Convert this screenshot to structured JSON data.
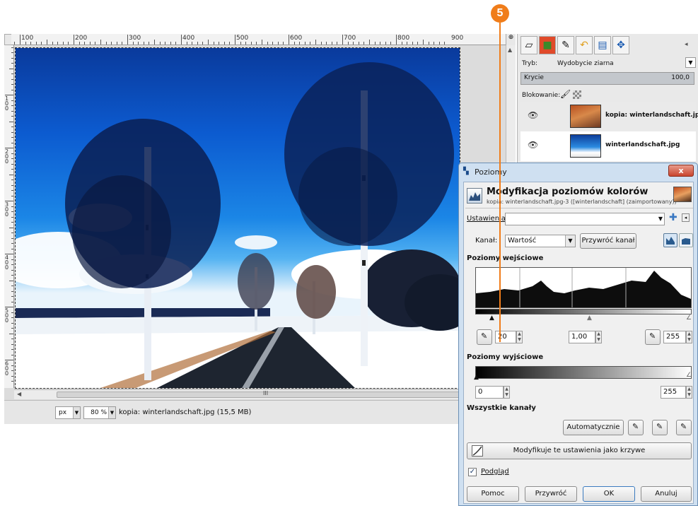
{
  "callout": {
    "number": "5",
    "color": "#f07d1a"
  },
  "main_window": {
    "ruler_labels": [
      "100",
      "200",
      "300",
      "400",
      "500",
      "600",
      "700",
      "800",
      "900"
    ],
    "left_ruler_labels": [
      "100",
      "200",
      "300",
      "400",
      "500",
      "600"
    ],
    "hscroll_grip": "III",
    "status": {
      "unit": "px",
      "zoom": "80 %",
      "image_info": "kopia: winterlandschaft.jpg (15,5 MB)"
    }
  },
  "layers_dock": {
    "mode_label": "Tryb:",
    "mode_value": "Wydobycie ziarna",
    "opacity_label": "Krycie",
    "opacity_value": "100,0",
    "lock_label": "Blokowanie:",
    "layers": [
      {
        "name": "kopia: winterlandschaft.jpg"
      },
      {
        "name": "winterlandschaft.jpg"
      }
    ]
  },
  "levels_dialog": {
    "window_title": "Poziomy",
    "close_label": "x",
    "heading": "Modyfikacja poziomów kolorów",
    "subheading": "kopia: winterlandschaft.jpg-3 ([winterlandschaft] (zaimportowany))",
    "presets_label": "Ustawienia:",
    "presets_value": "",
    "channel_label": "Kanał:",
    "channel_value": "Wartość",
    "reset_channel_label": "Przywróć kanał",
    "input_levels_label": "Poziomy wejściowe",
    "input_black": "20",
    "input_gamma": "1,00",
    "input_white": "255",
    "output_levels_label": "Poziomy wyjściowe",
    "output_black": "0",
    "output_white": "255",
    "all_channels_label": "Wszystkie kanały",
    "auto_label": "Automatycznie",
    "curves_label": "Modyfikuje te ustawienia jako krzywe",
    "preview_label": "Podgląd",
    "preview_checked": true,
    "buttons": {
      "help": "Pomoc",
      "reset": "Przywróć",
      "ok": "OK",
      "cancel": "Anuluj"
    }
  }
}
